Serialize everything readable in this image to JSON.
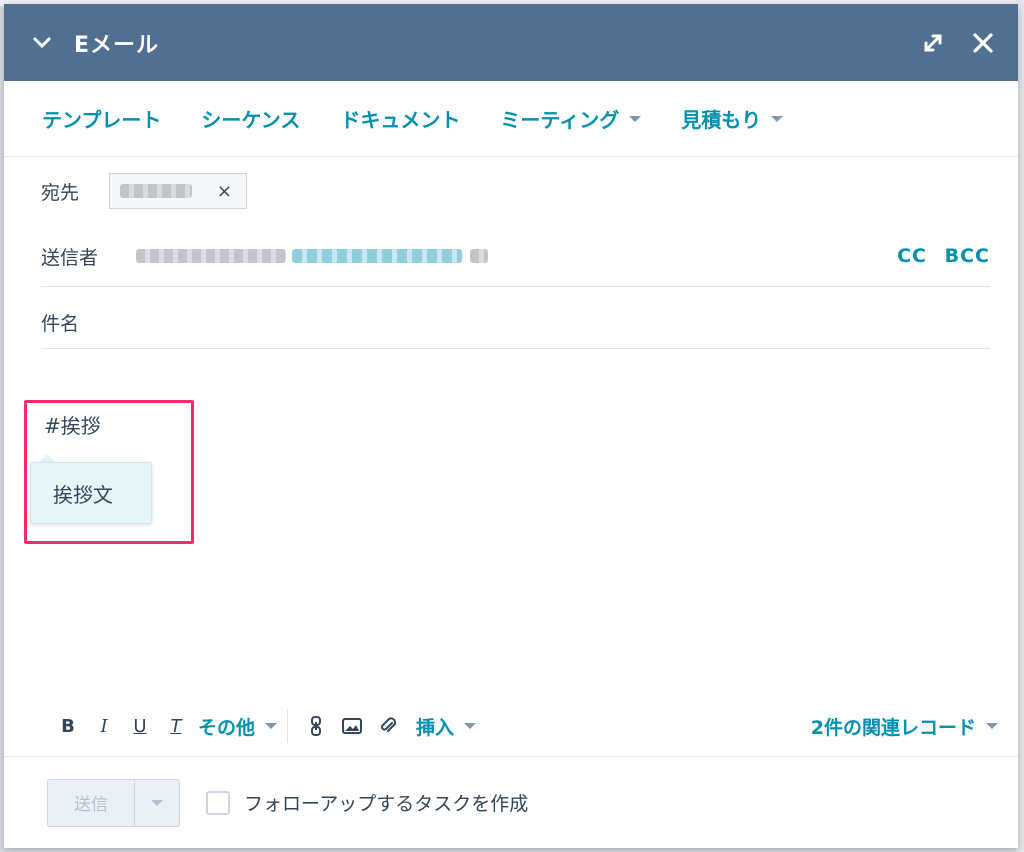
{
  "header": {
    "title": "Eメール"
  },
  "toolbar": {
    "templates": "テンプレート",
    "sequences": "シーケンス",
    "documents": "ドキュメント",
    "meetings": "ミーティング",
    "quotes": "見積もり"
  },
  "to": {
    "label": "宛先",
    "chip_remove": "×"
  },
  "from": {
    "label": "送信者",
    "cc": "CC",
    "bcc": "BCC"
  },
  "subject": {
    "label": "件名"
  },
  "body": {
    "typed_text": "#挨拶",
    "suggestion": "挨拶文"
  },
  "format": {
    "bold": "B",
    "italic": "I",
    "underline": "U",
    "clear": "T",
    "more": "その他",
    "insert": "挿入",
    "related": "2件の関連レコード"
  },
  "footer": {
    "send": "送信",
    "followup": "フォローアップするタスクを作成"
  }
}
